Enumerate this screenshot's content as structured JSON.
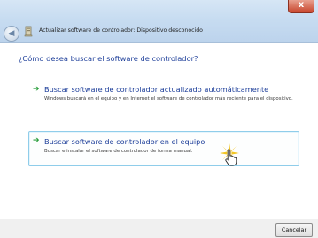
{
  "window": {
    "title": "Actualizar software de controlador: Dispositivo desconocido",
    "close_glyph": "x",
    "back_glyph": "◀"
  },
  "main": {
    "question": "¿Cómo desea buscar el software de controlador?",
    "options": [
      {
        "title": "Buscar software de controlador actualizado automáticamente",
        "description": "Windows buscará en el equipo y en Internet el software de controlador más reciente para el dispositivo.",
        "icon": "green-arrow-icon"
      },
      {
        "title": "Buscar software de controlador en el equipo",
        "description": "Buscar e instalar el software de controlador de forma manual.",
        "icon": "green-arrow-icon"
      }
    ]
  },
  "footer": {
    "cancel_label": "Cancelar"
  },
  "colors": {
    "link_blue": "#1e3f9a",
    "arrow_green": "#2a9e3c",
    "titlebar": "#c7dcf1",
    "close_red": "#c8452c"
  }
}
